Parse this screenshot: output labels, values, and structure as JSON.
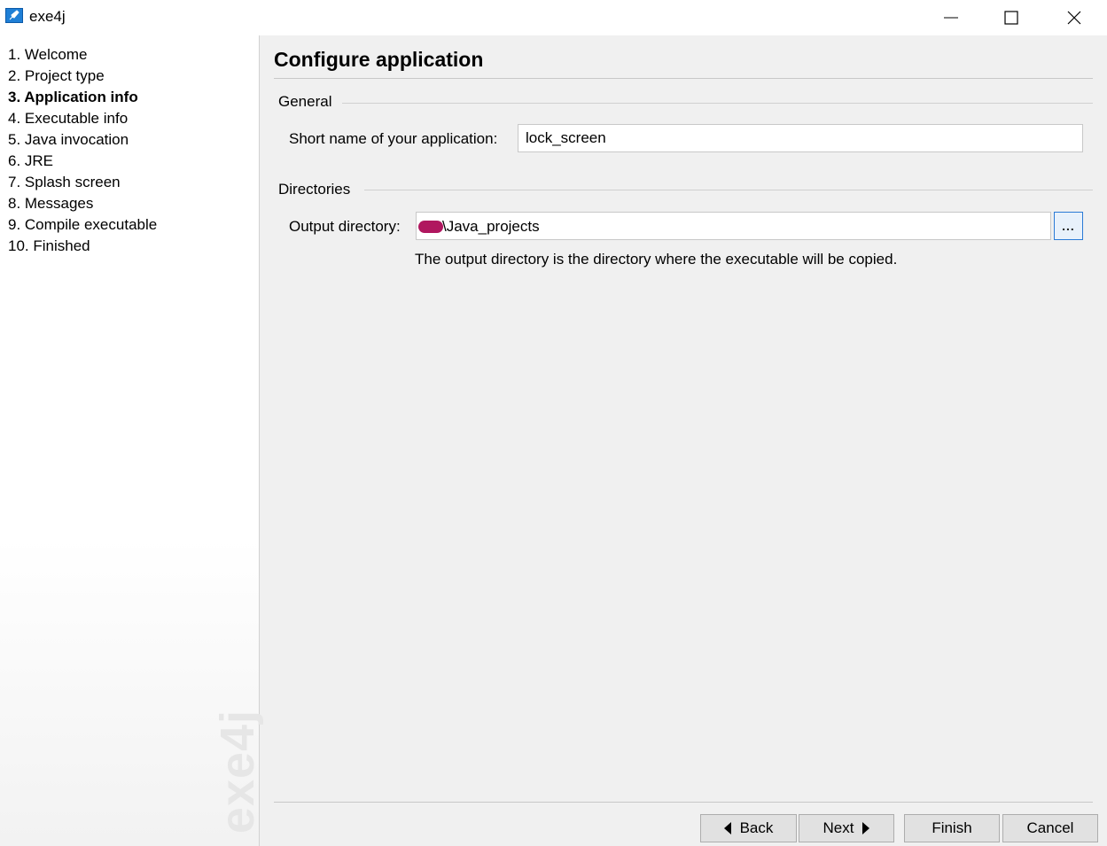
{
  "window": {
    "title": "exe4j",
    "icon": "exe4j-rocket-icon"
  },
  "sidebar": {
    "watermark": "exe4j",
    "items": [
      {
        "label": "1. Welcome",
        "active": false
      },
      {
        "label": "2. Project type",
        "active": false
      },
      {
        "label": "3. Application info",
        "active": true
      },
      {
        "label": "4. Executable info",
        "active": false
      },
      {
        "label": "5. Java invocation",
        "active": false
      },
      {
        "label": "6. JRE",
        "active": false
      },
      {
        "label": "7. Splash screen",
        "active": false
      },
      {
        "label": "8. Messages",
        "active": false
      },
      {
        "label": "9. Compile executable",
        "active": false
      },
      {
        "label": "10. Finished",
        "active": false
      }
    ]
  },
  "main": {
    "title": "Configure application",
    "general": {
      "section_label": "General",
      "short_name_label": "Short name of your application:",
      "short_name_value": "lock_screen"
    },
    "directories": {
      "section_label": "Directories",
      "output_label": "Output directory:",
      "output_value": "\\Java_projects",
      "browse_label": "...",
      "hint": "The output directory is the directory where the executable will be copied."
    }
  },
  "buttons": {
    "back": "Back",
    "next": "Next",
    "finish": "Finish",
    "cancel": "Cancel"
  },
  "colors": {
    "redaction": "#b0175f",
    "browse_border": "#2b7bd6"
  }
}
